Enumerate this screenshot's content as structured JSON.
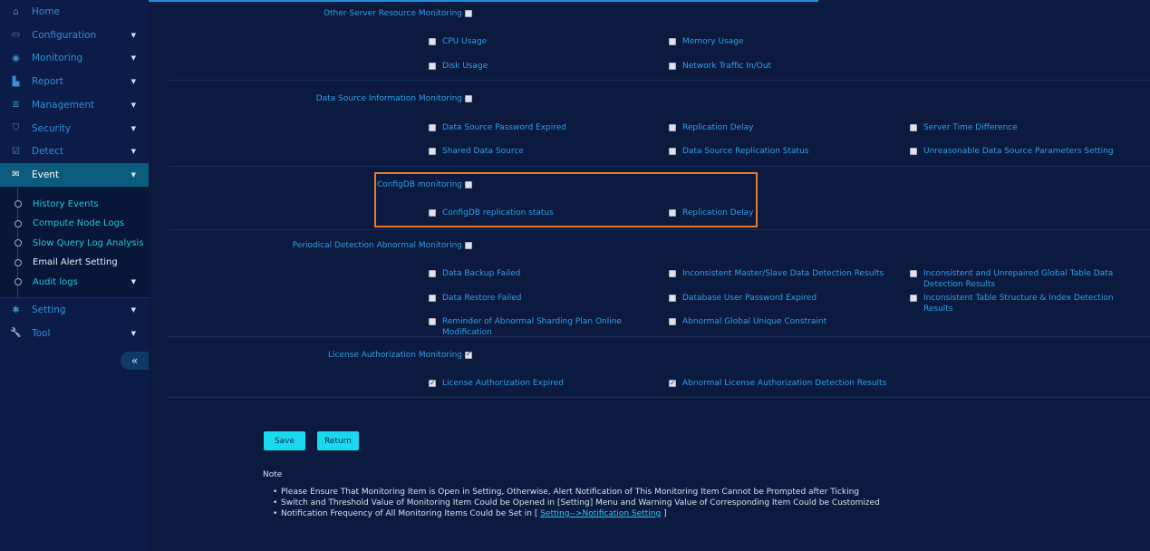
{
  "sidebar": {
    "items": [
      {
        "label": "Home",
        "icon": "home-icon",
        "glyph": "⌂",
        "caret": false
      },
      {
        "label": "Configuration",
        "icon": "monitor-icon",
        "glyph": "▭",
        "caret": true
      },
      {
        "label": "Monitoring",
        "icon": "eye-icon",
        "glyph": "◉",
        "caret": true
      },
      {
        "label": "Report",
        "icon": "area-chart-icon",
        "glyph": "▙",
        "caret": true
      },
      {
        "label": "Management",
        "icon": "database-icon",
        "glyph": "≣",
        "caret": true
      },
      {
        "label": "Security",
        "icon": "shield-icon",
        "glyph": "⛉",
        "caret": true
      },
      {
        "label": "Detect",
        "icon": "checkbox-icon",
        "glyph": "☑",
        "caret": true
      },
      {
        "label": "Event",
        "icon": "envelope-icon",
        "glyph": "✉",
        "caret": true,
        "active": true
      }
    ],
    "sub_items": [
      {
        "label": "History Events"
      },
      {
        "label": "Compute Node Logs"
      },
      {
        "label": "Slow Query Log Analysis"
      },
      {
        "label": "Email Alert Setting",
        "current": true
      },
      {
        "label": "Audit logs",
        "caret": true
      }
    ],
    "bottom_items": [
      {
        "label": "Setting",
        "icon": "gear-icon",
        "glyph": "✱",
        "caret": true
      },
      {
        "label": "Tool",
        "icon": "wrench-icon",
        "glyph": "🔧",
        "caret": true
      }
    ],
    "collapse_glyph": "«"
  },
  "sections": [
    {
      "label": "Other Server Resource Monitoring",
      "checked": false,
      "items": [
        {
          "label": "CPU Usage",
          "checked": false
        },
        {
          "label": "Memory Usage",
          "checked": false
        },
        {
          "label": "Disk Usage",
          "checked": false
        },
        {
          "label": "Network Traffic In/Out",
          "checked": false
        }
      ]
    },
    {
      "label": "Data Source Information Monitoring",
      "checked": false,
      "items": [
        {
          "label": "Data Source Password Expired",
          "checked": false
        },
        {
          "label": "Replication Delay",
          "checked": false
        },
        {
          "label": "Server Time Difference",
          "checked": false
        },
        {
          "label": "Shared Data Source",
          "checked": false
        },
        {
          "label": "Data Source Replication Status",
          "checked": false
        },
        {
          "label": "Unreasonable Data Source Parameters Setting",
          "checked": false
        }
      ]
    },
    {
      "label": "ConfigDB monitoring",
      "checked": false,
      "highlighted": true,
      "items": [
        {
          "label": "ConfigDB replication status",
          "checked": false
        },
        {
          "label": "Replication Delay",
          "checked": false
        }
      ]
    },
    {
      "label": "Periodical Detection Abnormal Monitoring",
      "checked": false,
      "items": [
        {
          "label": "Data Backup Failed",
          "checked": false
        },
        {
          "label": "Inconsistent Master/Slave Data Detection Results",
          "checked": false
        },
        {
          "label": "Inconsistent and Unrepaired Global Table Data Detection Results",
          "checked": false
        },
        {
          "label": "Data Restore Failed",
          "checked": false
        },
        {
          "label": "Database User Password Expired",
          "checked": false
        },
        {
          "label": "Inconsistent Table Structure & Index Detection Results",
          "checked": false
        },
        {
          "label": "Reminder of Abnormal Sharding Plan Online Modification",
          "checked": false
        },
        {
          "label": "Abnormal Global Unique Constraint",
          "checked": false
        }
      ]
    },
    {
      "label": "License Authorization Monitoring",
      "checked": true,
      "items": [
        {
          "label": "License Authorization Expired",
          "checked": true
        },
        {
          "label": "Abnormal License Authorization Detection Results",
          "checked": true
        }
      ]
    }
  ],
  "buttons": {
    "save": "Save",
    "return": "Return"
  },
  "note": {
    "title": "Note",
    "bullets": [
      "Please Ensure That Monitoring Item is Open in Setting, Otherwise, Alert Notification of This Monitoring Item Cannot be Prompted after Ticking",
      "Switch and Threshold Value of Monitoring Item Could be Opened in [Setting] Menu and Warning Value of Corresponding Item Could be Customized"
    ],
    "bullet3_prefix": "Notification Frequency of All Monitoring Items Could be Set in [ ",
    "bullet3_link": "Setting-->Notification Setting",
    "bullet3_suffix": " ]"
  },
  "colors": {
    "accent": "#1ad8ee",
    "highlight_border": "#e87a2a",
    "active_nav": "#0b5c7c",
    "label": "#2fa0e8"
  }
}
